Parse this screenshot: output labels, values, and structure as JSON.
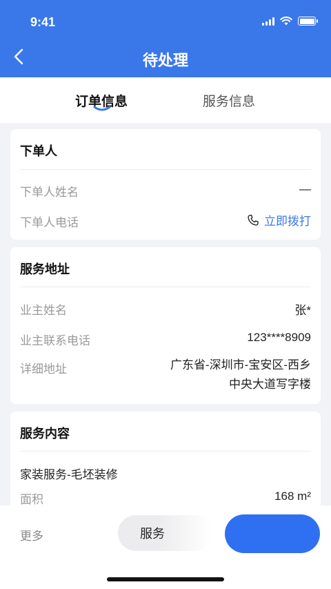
{
  "status": {
    "time": "9:41"
  },
  "header": {
    "title": "待处理"
  },
  "tabs": [
    {
      "label": "订单信息",
      "active": true
    },
    {
      "label": "服务信息",
      "active": false
    }
  ],
  "orderer": {
    "title": "下单人",
    "name_label": "下单人姓名",
    "name_value": "—",
    "phone_label": "下单人电话",
    "call_label": "立即拨打"
  },
  "address": {
    "title": "服务地址",
    "owner_label": "业主姓名",
    "owner_value": "张*",
    "phone_label": "业主联系电话",
    "phone_value": "123****8909",
    "detail_label": "详细地址",
    "detail_line1": "广东省-深圳市-宝安区-西乡",
    "detail_line2": "中央大道写字楼"
  },
  "content": {
    "title": "服务内容",
    "service_type": "家装服务-毛坯装修",
    "area_label": "面积",
    "area_value": "168 m²"
  },
  "bottom": {
    "more_label": "更多",
    "service_button_label": "服务"
  },
  "colors": {
    "primary": "#3a78ea"
  }
}
